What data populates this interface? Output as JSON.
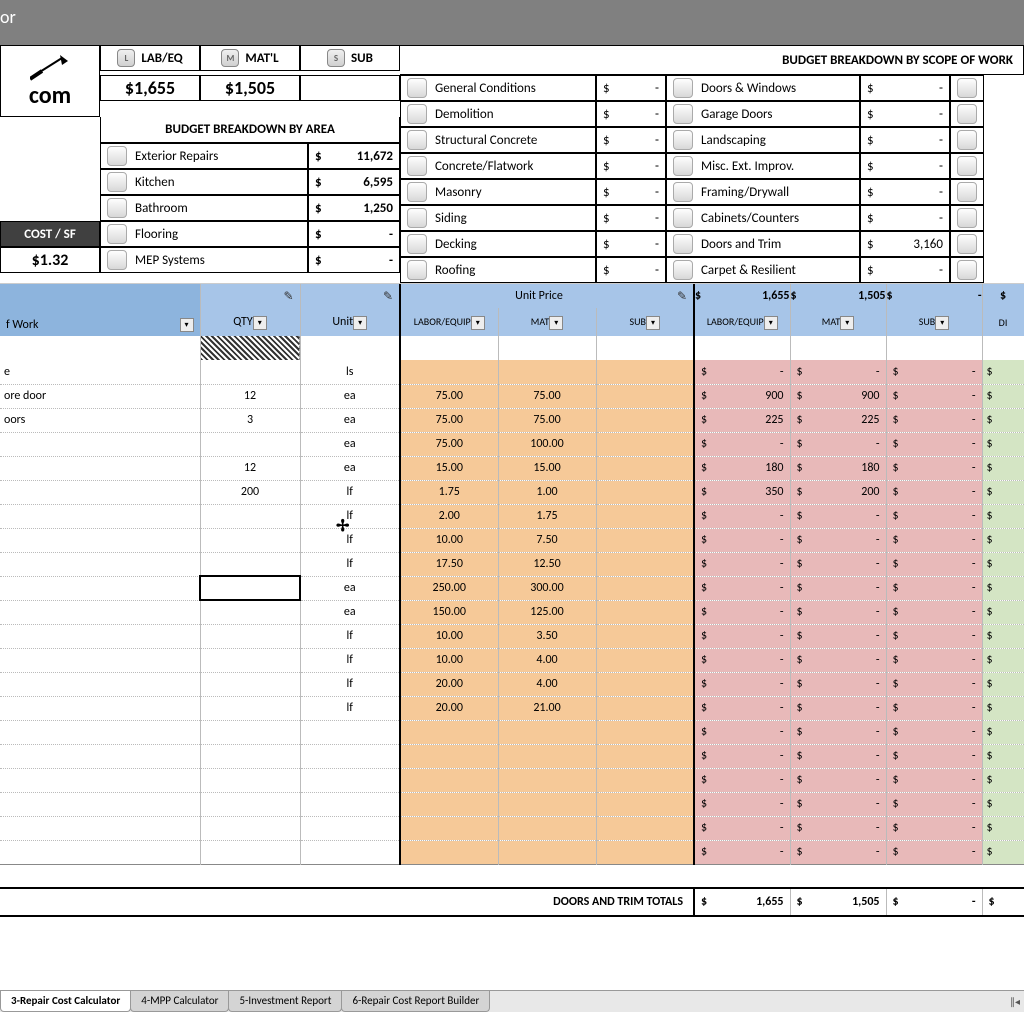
{
  "ribbon": {
    "title": "or"
  },
  "logo_text": "com",
  "header_buttons": {
    "labeq": {
      "badge": "L",
      "label": "LAB/EQ"
    },
    "matl": {
      "badge": "M",
      "label": "MAT'L"
    },
    "sub": {
      "badge": "S",
      "label": "SUB"
    }
  },
  "totals": {
    "labeq": "$1,655",
    "matl": "$1,505"
  },
  "breakdown_area_title": "BUDGET BREAKDOWN BY AREA",
  "breakdown_scope_title": "BUDGET BREAKDOWN BY SCOPE OF WORK",
  "cost_sf_label": "COST / SF",
  "cost_sf_value": "$1.32",
  "areas": [
    {
      "label": "Exterior Repairs",
      "value": "11,672"
    },
    {
      "label": "Kitchen",
      "value": "6,595"
    },
    {
      "label": "Bathroom",
      "value": "1,250"
    },
    {
      "label": "Flooring",
      "value": "-"
    },
    {
      "label": "MEP Systems",
      "value": "-"
    }
  ],
  "scope_left": [
    {
      "label": "General Conditions",
      "value": "-"
    },
    {
      "label": "Demolition",
      "value": "-"
    },
    {
      "label": "Structural Concrete",
      "value": "-"
    },
    {
      "label": "Concrete/Flatwork",
      "value": "-"
    },
    {
      "label": "Masonry",
      "value": "-"
    },
    {
      "label": "Siding",
      "value": "-"
    },
    {
      "label": "Decking",
      "value": "-"
    },
    {
      "label": "Roofing",
      "value": "-"
    }
  ],
  "scope_right": [
    {
      "label": "Doors & Windows",
      "value": "-"
    },
    {
      "label": "Garage Doors",
      "value": "-"
    },
    {
      "label": "Landscaping",
      "value": "-"
    },
    {
      "label": "Misc. Ext. Improv.",
      "value": "-"
    },
    {
      "label": "Framing/Drywall",
      "value": "-"
    },
    {
      "label": "Cabinets/Counters",
      "value": "-"
    },
    {
      "label": "Doors and Trim",
      "value": "3,160"
    },
    {
      "label": "Carpet & Resilient",
      "value": "-"
    }
  ],
  "col_headers": {
    "scope": "f Work",
    "qty": "QTY",
    "unit": "Unit",
    "unit_price": "Unit Price",
    "labor": "LABOR/EQUIP",
    "mat": "MAT",
    "sub": "SUB",
    "labor2": "LABOR/EQUIP",
    "mat2": "MAT",
    "sub2": "SUB",
    "diy": "DI"
  },
  "totals_header": {
    "labor": "1,655",
    "mat": "1,505",
    "sub": "-"
  },
  "grid_rows": [
    {
      "desc": "e",
      "qty": "",
      "unit": "ls",
      "lp": "",
      "mp": "",
      "lab": "-",
      "mat": "-",
      "sub": "-"
    },
    {
      "desc": "ore door",
      "qty": "12",
      "unit": "ea",
      "lp": "75.00",
      "mp": "75.00",
      "lab": "900",
      "mat": "900",
      "sub": "-"
    },
    {
      "desc": "oors",
      "qty": "3",
      "unit": "ea",
      "lp": "75.00",
      "mp": "75.00",
      "lab": "225",
      "mat": "225",
      "sub": "-"
    },
    {
      "desc": "",
      "qty": "",
      "unit": "ea",
      "lp": "75.00",
      "mp": "100.00",
      "lab": "-",
      "mat": "-",
      "sub": "-"
    },
    {
      "desc": "",
      "qty": "12",
      "unit": "ea",
      "lp": "15.00",
      "mp": "15.00",
      "lab": "180",
      "mat": "180",
      "sub": "-"
    },
    {
      "desc": "",
      "qty": "200",
      "unit": "lf",
      "lp": "1.75",
      "mp": "1.00",
      "lab": "350",
      "mat": "200",
      "sub": "-"
    },
    {
      "desc": "",
      "qty": "",
      "unit": "lf",
      "lp": "2.00",
      "mp": "1.75",
      "lab": "-",
      "mat": "-",
      "sub": "-"
    },
    {
      "desc": "",
      "qty": "",
      "unit": "lf",
      "lp": "10.00",
      "mp": "7.50",
      "lab": "-",
      "mat": "-",
      "sub": "-"
    },
    {
      "desc": "",
      "qty": "",
      "unit": "lf",
      "lp": "17.50",
      "mp": "12.50",
      "lab": "-",
      "mat": "-",
      "sub": "-"
    },
    {
      "desc": "",
      "qty": "",
      "unit": "ea",
      "lp": "250.00",
      "mp": "300.00",
      "lab": "-",
      "mat": "-",
      "sub": "-"
    },
    {
      "desc": "",
      "qty": "",
      "unit": "ea",
      "lp": "150.00",
      "mp": "125.00",
      "lab": "-",
      "mat": "-",
      "sub": "-"
    },
    {
      "desc": "",
      "qty": "",
      "unit": "lf",
      "lp": "10.00",
      "mp": "3.50",
      "lab": "-",
      "mat": "-",
      "sub": "-"
    },
    {
      "desc": "",
      "qty": "",
      "unit": "lf",
      "lp": "10.00",
      "mp": "4.00",
      "lab": "-",
      "mat": "-",
      "sub": "-"
    },
    {
      "desc": "",
      "qty": "",
      "unit": "lf",
      "lp": "20.00",
      "mp": "4.00",
      "lab": "-",
      "mat": "-",
      "sub": "-"
    },
    {
      "desc": "",
      "qty": "",
      "unit": "lf",
      "lp": "20.00",
      "mp": "21.00",
      "lab": "-",
      "mat": "-",
      "sub": "-"
    },
    {
      "desc": "",
      "qty": "",
      "unit": "",
      "lp": "",
      "mp": "",
      "lab": "-",
      "mat": "-",
      "sub": "-"
    },
    {
      "desc": "",
      "qty": "",
      "unit": "",
      "lp": "",
      "mp": "",
      "lab": "-",
      "mat": "-",
      "sub": "-"
    },
    {
      "desc": "",
      "qty": "",
      "unit": "",
      "lp": "",
      "mp": "",
      "lab": "-",
      "mat": "-",
      "sub": "-"
    },
    {
      "desc": "",
      "qty": "",
      "unit": "",
      "lp": "",
      "mp": "",
      "lab": "-",
      "mat": "-",
      "sub": "-"
    },
    {
      "desc": "",
      "qty": "",
      "unit": "",
      "lp": "",
      "mp": "",
      "lab": "-",
      "mat": "-",
      "sub": "-"
    },
    {
      "desc": "",
      "qty": "",
      "unit": "",
      "lp": "",
      "mp": "",
      "lab": "-",
      "mat": "-",
      "sub": "-"
    }
  ],
  "section_total_label": "DOORS AND TRIM TOTALS",
  "section_totals": {
    "lab": "1,655",
    "mat": "1,505",
    "sub": "-"
  },
  "sheet_tabs": [
    "3-Repair Cost Calculator",
    "4-MPP Calculator",
    "5-Investment Report",
    "6-Repair Cost Report Builder"
  ]
}
